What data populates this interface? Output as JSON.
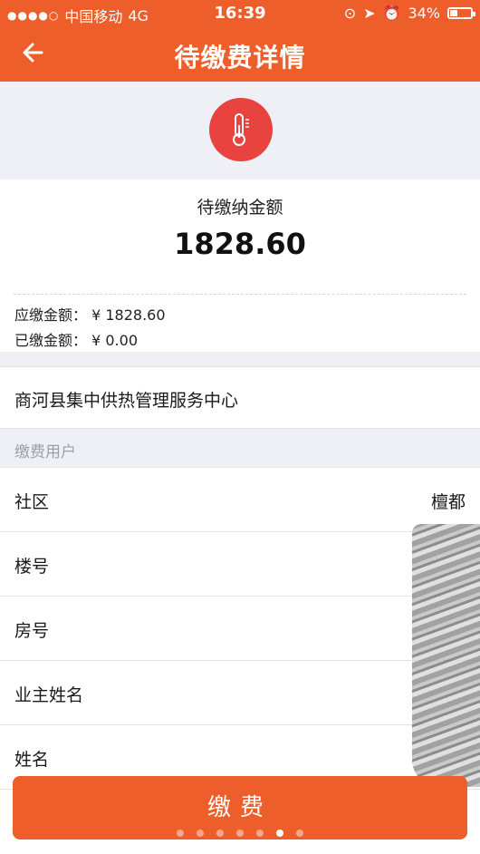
{
  "status_bar": {
    "carrier": "中国移动",
    "network": "4G",
    "time": "16:39",
    "battery": "34%"
  },
  "nav": {
    "title": "待缴费详情",
    "back_icon": "arrow-left-icon"
  },
  "hero": {
    "icon": "thermometer-icon",
    "icon_color": "#e8433f"
  },
  "amount": {
    "label": "待缴纳金额",
    "value": "1828.60",
    "due_label": "应缴金额：",
    "due_value": "¥ 1828.60",
    "paid_label": "已缴金额：",
    "paid_value": "¥ 0.00"
  },
  "organization": "商河县集中供热管理服务中心",
  "section_title": "缴费用户",
  "fields": [
    {
      "label": "社区",
      "value": "檀都"
    },
    {
      "label": "楼号",
      "value": ""
    },
    {
      "label": "房号",
      "value": ""
    },
    {
      "label": "业主姓名",
      "value": ""
    },
    {
      "label": "姓名",
      "value": ""
    }
  ],
  "pay_button": "缴费",
  "pager": {
    "count": 7,
    "active_index": 5
  },
  "colors": {
    "accent": "#ee5e2a",
    "section_bg": "#eef0f6"
  }
}
